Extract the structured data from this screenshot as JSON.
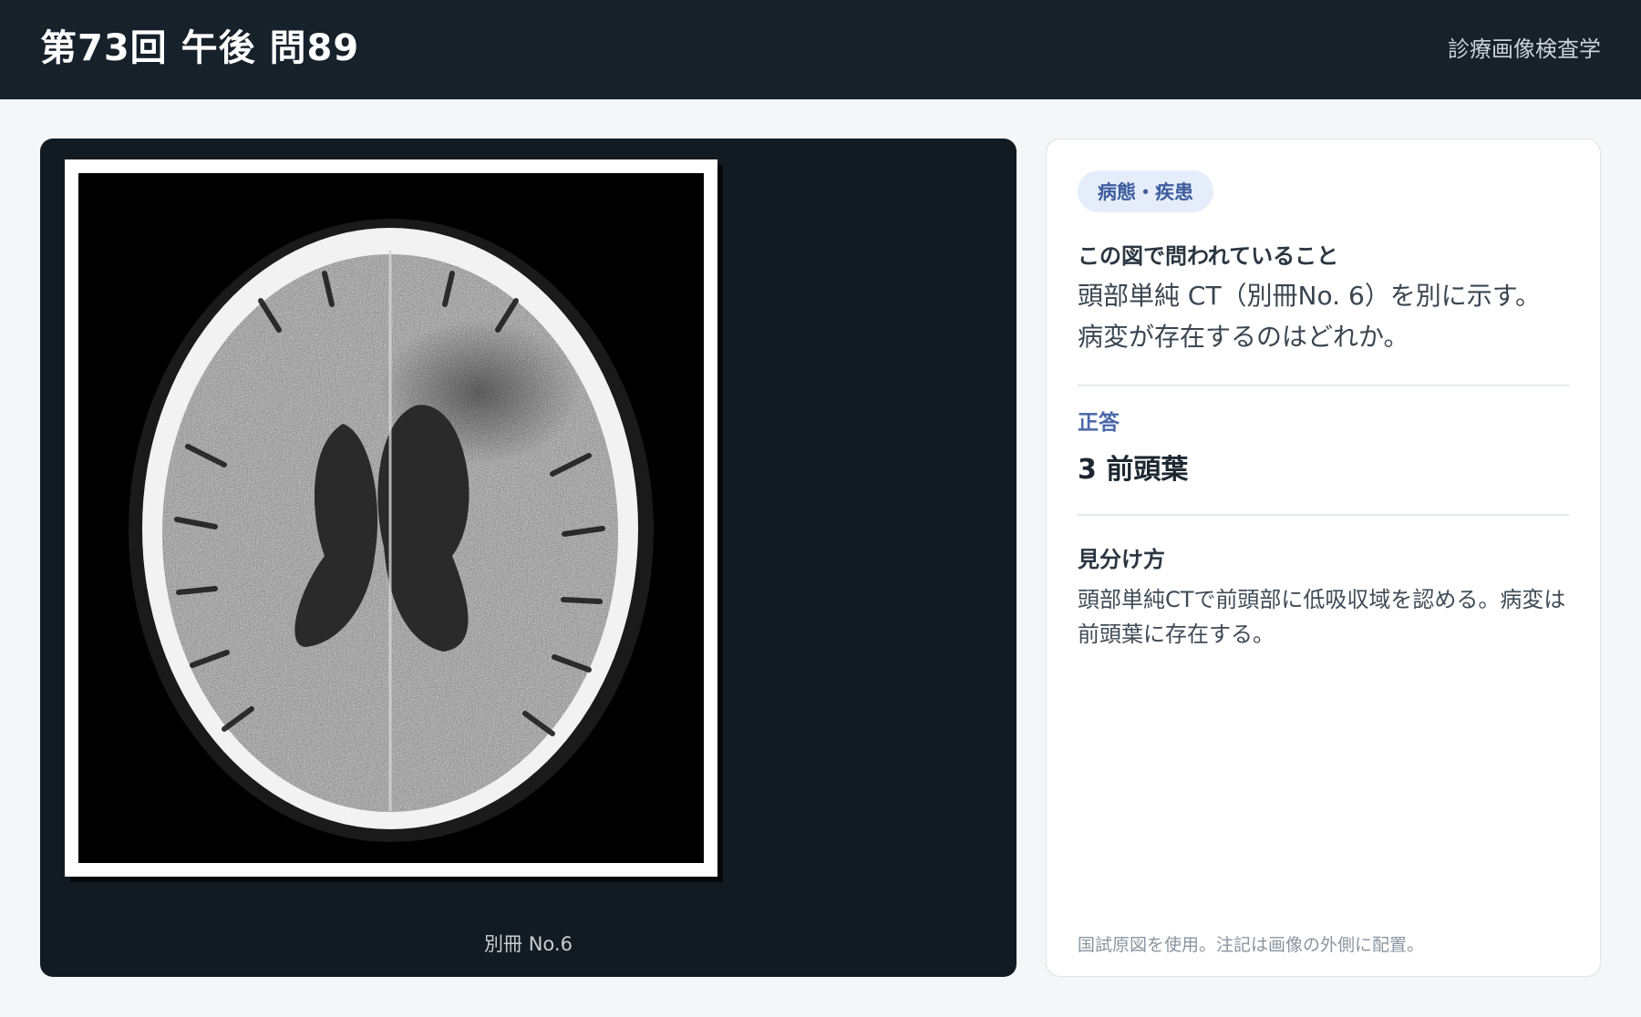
{
  "header": {
    "title": "第73回 午後 問89",
    "subject": "診療画像検査学"
  },
  "image_panel": {
    "caption": "別冊 No.6"
  },
  "info": {
    "badge": "病態・疾患",
    "question_heading": "この図で問われていること",
    "question_line1": "頭部単純 CT（別冊No. 6）を別に示す。",
    "question_line2": "病変が存在するのはどれか。",
    "answer_label": "正答",
    "answer_value": "3 前頭葉",
    "method_heading": "見分け方",
    "method_text": "頭部単純CTで前頭部に低吸収域を認める。病変は前頭葉に存在する。",
    "footnote": "国試原図を使用。注記は画像の外側に配置。"
  }
}
